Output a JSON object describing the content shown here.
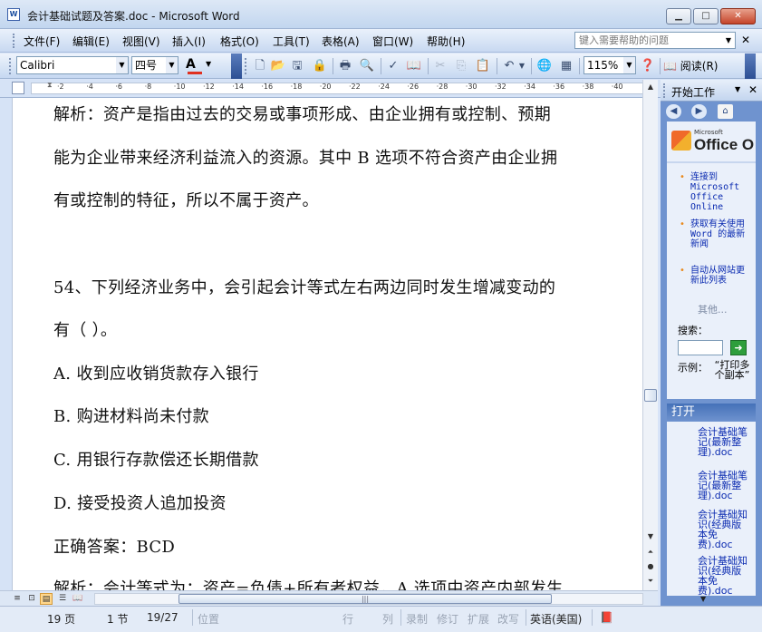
{
  "window": {
    "title": "会计基础试题及答案.doc - Microsoft Word",
    "app_icon": "W",
    "minimize_icon": "minimize-icon",
    "maximize_icon": "maximize-icon",
    "close_icon": "close-icon"
  },
  "menu": {
    "items": [
      "文件(F)",
      "编辑(E)",
      "视图(V)",
      "插入(I)",
      "格式(O)",
      "工具(T)",
      "表格(A)",
      "窗口(W)",
      "帮助(H)"
    ],
    "help_placeholder": "键入需要帮助的问题"
  },
  "toolbar": {
    "font_name": "Calibri",
    "font_size": "四号",
    "font_color_label": "A",
    "zoom": "115%",
    "read_label": "阅读(R)"
  },
  "ruler": {
    "ticks": [
      "2",
      "4",
      "6",
      "8",
      "10",
      "12",
      "14",
      "16",
      "18",
      "20",
      "22",
      "24",
      "26",
      "28",
      "30",
      "32",
      "34",
      "36",
      "38",
      "40"
    ]
  },
  "document": {
    "lines": [
      "解析：资产是指由过去的交易或事项形成、由企业拥有或控制、预期",
      "能为企业带来经济利益流入的资源。其中 B 选项不符合资产由企业拥",
      "有或控制的特征，所以不属于资产。",
      "54、下列经济业务中，会引起会计等式左右两边同时发生增减变动的",
      "有（ ）。",
      "A. 收到应收销货款存入银行",
      "B. 购进材料尚未付款",
      "C. 用银行存款偿还长期借款",
      "D. 接受投资人追加投资",
      "正确答案：BCD",
      "解析：会计等式为：资产=负债+所有者权益，A 选项中资产内部发生"
    ]
  },
  "taskpane": {
    "title": "开始工作",
    "logo_ms": "Microsoft",
    "logo_text": "Office O",
    "links": [
      "连接到 Microsoft Office Online",
      "获取有关使用 Word 的最新新闻",
      "自动从网站更新此列表"
    ],
    "more": "其他...",
    "search_label": "搜索：",
    "example_label": "示例：",
    "example_text": "“打印多个副本”",
    "open_section": "打开",
    "files": [
      "会计基础笔记(最新整理).doc",
      "会计基础笔记(最新整理).doc",
      "会计基础知识(经典版本免费).doc",
      "会计基础知识(经典版本免费).doc"
    ]
  },
  "status": {
    "page": "19 页",
    "section": "1 节",
    "page_of": "19/27",
    "position": "位置",
    "line": "行",
    "col": "列",
    "rec": "录制",
    "trk": "修订",
    "ext": "扩展",
    "ovr": "改写",
    "language": "英语(美国)"
  },
  "colors": {
    "titlebar": "#c2d6ef",
    "taskpane": "#6f93cf",
    "link": "#0a2ab0",
    "font_color_bar": "#e03020"
  }
}
